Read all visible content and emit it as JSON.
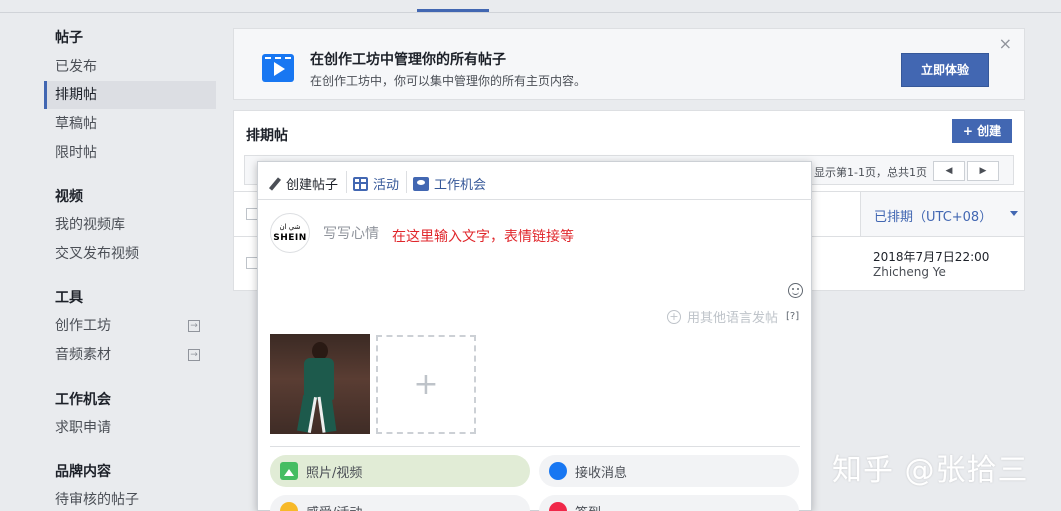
{
  "sidebar": {
    "sections": [
      {
        "title": "帖子",
        "items": [
          "已发布",
          "排期帖",
          "草稿帖",
          "限时帖"
        ]
      },
      {
        "title": "视频",
        "items": [
          "我的视频库",
          "交叉发布视频"
        ]
      },
      {
        "title": "工具",
        "items": [
          "创作工坊",
          "音频素材"
        ]
      },
      {
        "title": "工作机会",
        "items": [
          "求职申请"
        ]
      },
      {
        "title": "品牌内容",
        "items": [
          "待审核的帖子"
        ]
      }
    ],
    "active_item": "排期帖"
  },
  "banner": {
    "title": "在创作工坊中管理你的所有帖子",
    "subtitle": "在创作工坊中，你可以集中管理你的所有主页内容。",
    "cta": "立即体验",
    "close": "×"
  },
  "panel": {
    "title": "排期帖",
    "create_label": "+ 创建",
    "pager_text": "显示第1-1页，总共1页",
    "prev": "◀",
    "next": "▶",
    "column_header": "已排期（UTC+08）",
    "row": {
      "date": "2018年7月7日22:00",
      "author": "Zhicheng Ye"
    }
  },
  "composer": {
    "tabs": [
      {
        "label": "创建帖子",
        "icon": "pencil-icon"
      },
      {
        "label": "活动",
        "icon": "calendar-icon"
      },
      {
        "label": "工作机会",
        "icon": "briefcase-icon"
      }
    ],
    "avatar_line1": "شي ان",
    "avatar_line2": "SHEIN",
    "placeholder": "写写心情",
    "annotation": "在这里输入文字，表情链接等",
    "other_language": "用其他语言发帖",
    "help": "[?]",
    "add_photo": "+",
    "actions": [
      {
        "label": "照片/视频",
        "icon": "photo-icon"
      },
      {
        "label": "接收消息",
        "icon": "messenger-icon"
      },
      {
        "label": "感受/活动",
        "icon": "feeling-icon"
      },
      {
        "label": "签到",
        "icon": "location-pin-icon"
      }
    ]
  },
  "watermark": "知乎 @张拾三"
}
